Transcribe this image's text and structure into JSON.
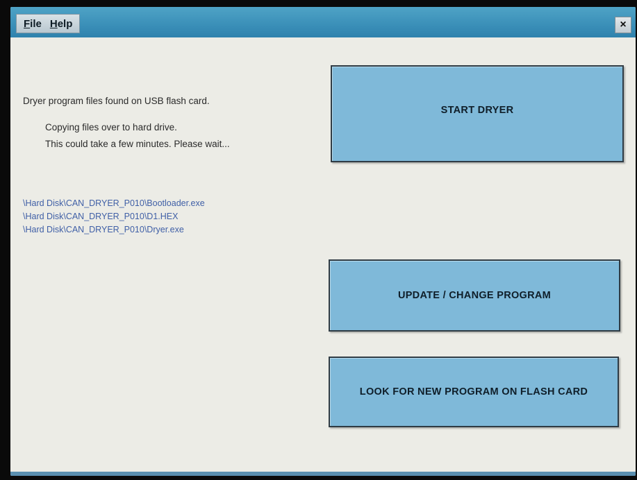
{
  "menubar": {
    "file_label": "File",
    "help_label": "Help",
    "close_label": "×"
  },
  "status": {
    "found_message": "Dryer program files found on USB flash card.",
    "copying_message": "Copying files over to hard drive.",
    "wait_message": "This could take a few minutes.  Please wait..."
  },
  "files": [
    "\\Hard Disk\\CAN_DRYER_P010\\Bootloader.exe",
    "\\Hard Disk\\CAN_DRYER_P010\\D1.HEX",
    "\\Hard Disk\\CAN_DRYER_P010\\Dryer.exe"
  ],
  "buttons": {
    "start_dryer": "START DRYER",
    "update_program": "UPDATE / CHANGE PROGRAM",
    "look_for_program": "LOOK FOR NEW PROGRAM ON FLASH CARD"
  },
  "colors": {
    "menubar": "#3a8fb8",
    "button_fill": "#7fb9d9",
    "file_text": "#3f5fa6",
    "background": "#ecece6"
  }
}
